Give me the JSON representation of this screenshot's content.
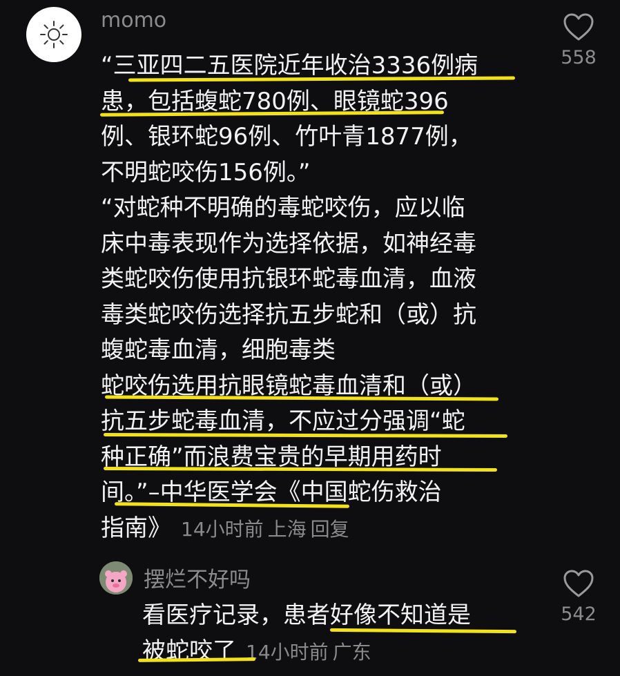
{
  "comment": {
    "username": "momo",
    "likes": "558",
    "lines": [
      "“三亚四二五医院近年收治3336例病",
      "患，包括蝮蛇780例、眼镜蛇396",
      "例、银环蛇96例、竹叶青1877例，",
      "不明蛇咬伤156例。”",
      "“对蛇种不明确的毒蛇咬伤，应以临",
      "床中毒表现作为选择依据，如神经毒",
      "类蛇咬伤使用抗银环蛇毒血清，血液",
      "毒类蛇咬伤选择抗五步蛇和（或）抗",
      "蝮蛇毒血清，细胞毒类",
      "蛇咬伤选用抗眼镜蛇毒血清和（或）",
      "抗五步蛇毒血清，不应过分强调“蛇",
      "种正确”而浪费宝贵的早期用药时",
      "间。”–中华医学会《中国蛇伤救治"
    ],
    "last_line": "指南》",
    "time": "14小时前",
    "location": "上海",
    "reply_label": "回复"
  },
  "reply": {
    "username": "摆烂不好吗",
    "likes": "542",
    "lines": [
      "看医疗记录，患者好像不知道是"
    ],
    "last_line": "被蛇咬了",
    "time": "14小时前",
    "location": "广东"
  },
  "colors": {
    "background": "#0e0e10",
    "text": "#f2f2f2",
    "muted": "#8c8c8c",
    "underline": "#f3e21a"
  },
  "icons": {
    "avatar_main": "sun-icon",
    "like": "heart-outline-icon",
    "avatar_sub": "pink-bear-avatar"
  }
}
